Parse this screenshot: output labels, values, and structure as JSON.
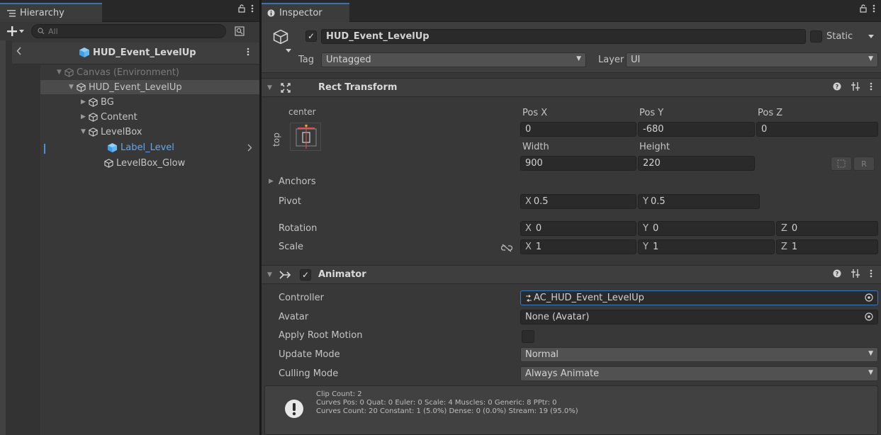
{
  "hierarchy": {
    "tab_label": "Hierarchy",
    "search_placeholder": "All",
    "scene_title": "HUD_Event_LevelUp",
    "tree": [
      {
        "label": "Canvas (Environment)",
        "dim": true
      },
      {
        "label": "HUD_Event_LevelUp",
        "selected": true
      },
      {
        "label": "BG"
      },
      {
        "label": "Content"
      },
      {
        "label": "LevelBox"
      },
      {
        "label": "Label_Level",
        "highlighted": true
      },
      {
        "label": "LevelBox_Glow"
      }
    ]
  },
  "inspector": {
    "tab_label": "Inspector",
    "object": {
      "active": true,
      "name": "HUD_Event_LevelUp",
      "static_label": "Static",
      "tag_label": "Tag",
      "tag_value": "Untagged",
      "layer_label": "Layer",
      "layer_value": "UI"
    },
    "rect_transform": {
      "title": "Rect Transform",
      "anchor_h": "center",
      "anchor_v": "top",
      "pos_x_label": "Pos X",
      "pos_x": "0",
      "pos_y_label": "Pos Y",
      "pos_y": "-680",
      "pos_z_label": "Pos Z",
      "pos_z": "0",
      "width_label": "Width",
      "width": "900",
      "height_label": "Height",
      "height": "220",
      "raw_button_label": "R",
      "anchors_label": "Anchors",
      "pivot_label": "Pivot",
      "pivot_x": "0.5",
      "pivot_y": "0.5",
      "rotation_label": "Rotation",
      "rot_x": "0",
      "rot_y": "0",
      "rot_z": "0",
      "scale_label": "Scale",
      "scale_x": "1",
      "scale_y": "1",
      "scale_z": "1",
      "axis_x": "X",
      "axis_y": "Y",
      "axis_z": "Z"
    },
    "animator": {
      "title": "Animator",
      "enabled": true,
      "controller_label": "Controller",
      "controller_value": "AC_HUD_Event_LevelUp",
      "avatar_label": "Avatar",
      "avatar_value": "None (Avatar)",
      "apply_root_motion_label": "Apply Root Motion",
      "apply_root_motion": false,
      "update_mode_label": "Update Mode",
      "update_mode_value": "Normal",
      "culling_mode_label": "Culling Mode",
      "culling_mode_value": "Always Animate",
      "info_lines": [
        "Clip Count: 2",
        "Curves Pos: 0 Quat: 0 Euler: 0 Scale: 4 Muscles: 0 Generic: 8 PPtr: 0",
        "Curves Count: 20 Constant: 1 (5.0%) Dense: 0 (0.0%) Stream: 19 (95.0%)"
      ]
    }
  },
  "colors": {
    "accent_blue": "#4d90d8",
    "label_blue": "#5fa8f0",
    "prefab_blue": "#63b8f0",
    "background": "#383838"
  }
}
